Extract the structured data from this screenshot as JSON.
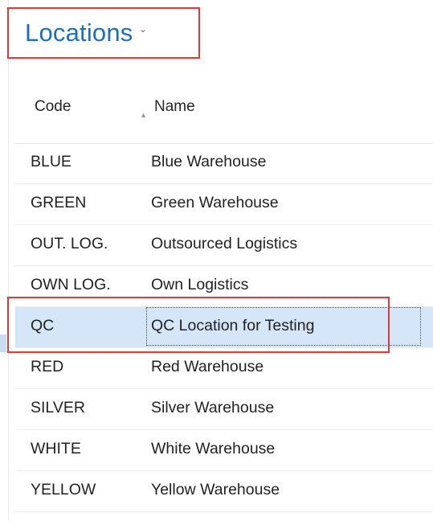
{
  "page": {
    "title": "Locations"
  },
  "table": {
    "columns": [
      "Code",
      "Name"
    ],
    "selected_index": 4,
    "rows": [
      {
        "code": "BLUE",
        "name": "Blue Warehouse"
      },
      {
        "code": "GREEN",
        "name": "Green Warehouse"
      },
      {
        "code": "OUT. LOG.",
        "name": "Outsourced Logistics"
      },
      {
        "code": "OWN LOG.",
        "name": "Own Logistics"
      },
      {
        "code": "QC",
        "name": "QC Location for Testing"
      },
      {
        "code": "RED",
        "name": "Red Warehouse"
      },
      {
        "code": "SILVER",
        "name": "Silver Warehouse"
      },
      {
        "code": "WHITE",
        "name": "White Warehouse"
      },
      {
        "code": "YELLOW",
        "name": "Yellow Warehouse"
      }
    ]
  },
  "colors": {
    "title": "#1a6fc0",
    "selected_row": "#d4e6f7",
    "annotation": "#e53935"
  }
}
